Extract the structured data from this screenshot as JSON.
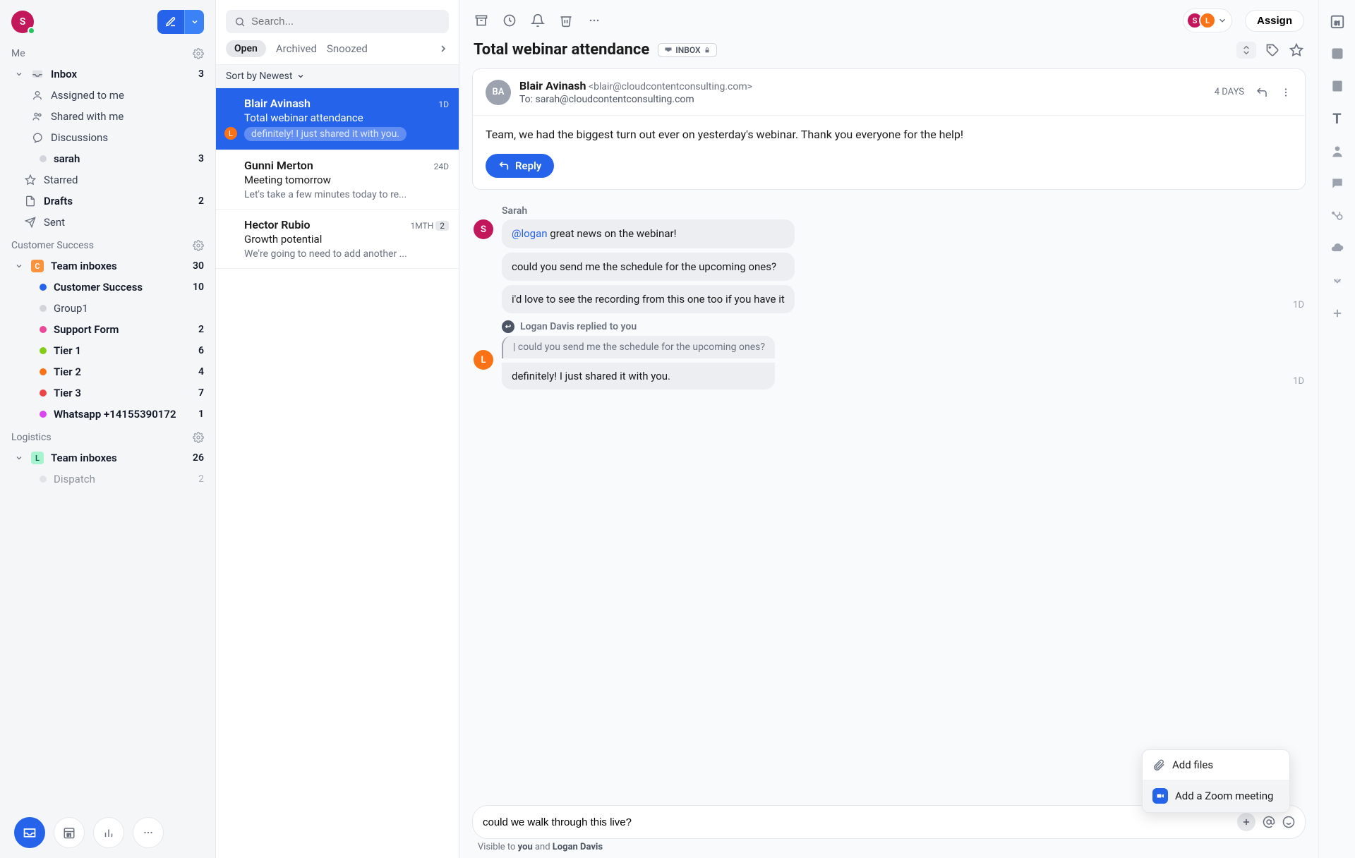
{
  "user_avatar_letter": "S",
  "sidebar": {
    "sections": [
      {
        "name": "Me"
      },
      {
        "name": "Customer Success"
      },
      {
        "name": "Logistics"
      }
    ],
    "me_items": {
      "inbox": {
        "label": "Inbox",
        "count": "3"
      },
      "assigned": {
        "label": "Assigned to me"
      },
      "shared": {
        "label": "Shared with me"
      },
      "discussions": {
        "label": "Discussions"
      },
      "sarah": {
        "label": "sarah",
        "count": "3"
      },
      "starred": {
        "label": "Starred"
      },
      "drafts": {
        "label": "Drafts",
        "count": "2"
      },
      "sent": {
        "label": "Sent"
      }
    },
    "cs": {
      "team": {
        "label": "Team inboxes",
        "count": "30"
      },
      "items": [
        {
          "label": "Customer Success",
          "count": "10",
          "color": "#2563eb"
        },
        {
          "label": "Group1",
          "count": "",
          "color": "#d1d5db"
        },
        {
          "label": "Support Form",
          "count": "2",
          "color": "#ec4899"
        },
        {
          "label": "Tier 1",
          "count": "6",
          "color": "#84cc16"
        },
        {
          "label": "Tier 2",
          "count": "4",
          "color": "#f97316"
        },
        {
          "label": "Tier 3",
          "count": "7",
          "color": "#ef4444"
        },
        {
          "label": "Whatsapp +14155390172",
          "count": "1",
          "color": "#d946ef"
        }
      ]
    },
    "logistics": {
      "team": {
        "label": "Team inboxes",
        "count": "26"
      },
      "items": [
        {
          "label": "Dispatch",
          "count": "2",
          "color": "#d1d5db"
        }
      ]
    }
  },
  "list": {
    "search_placeholder": "Search...",
    "tabs": {
      "open": "Open",
      "archived": "Archived",
      "snoozed": "Snoozed"
    },
    "sort": "Sort by Newest",
    "items": [
      {
        "sender": "Blair Avinash",
        "time": "1D",
        "subject": "Total webinar attendance",
        "preview": "definitely! I just shared it with you.",
        "selected": true,
        "badge": "L"
      },
      {
        "sender": "Gunni Merton",
        "time": "24D",
        "subject": "Meeting tomorrow",
        "preview": "Let's take a few minutes today to re..."
      },
      {
        "sender": "Hector Rubio",
        "time": "1MTH",
        "subject": "Growth potential",
        "preview": "We're going to need to add another ...",
        "num": "2"
      }
    ]
  },
  "reader": {
    "assign": "Assign",
    "title": "Total webinar attendance",
    "inbox_tag": "INBOX",
    "email": {
      "from_name": "Blair Avinash",
      "from_email": "<blair@cloudcontentconsulting.com>",
      "to_label": "To: sarah@cloudcontentconsulting.com",
      "age": "4 DAYS",
      "avatar": "BA",
      "body": "Team, we had the biggest turn out ever on yesterday's webinar. Thank you everyone for the help!",
      "reply_btn": "Reply"
    },
    "thread": {
      "sarah": {
        "name": "Sarah",
        "letter": "S",
        "mention": "@logan",
        "msg1_rest": " great news on the webinar!",
        "msg2": "could you send me the schedule for the upcoming ones?",
        "msg3": "i'd love to see the recording from this one too if you have it",
        "time": "1D"
      },
      "logan": {
        "note": "Logan Davis replied to you",
        "letter": "L",
        "quote": "could you send me the schedule for the upcoming ones?",
        "reply": "definitely! I just shared it with you.",
        "time": "1D"
      }
    },
    "popup": {
      "files": "Add files",
      "zoom": "Add a Zoom meeting"
    },
    "composer_value": "could we walk through this live?",
    "visibility_prefix": "Visible to ",
    "visibility_you": "you",
    "visibility_and": " and ",
    "visibility_other": "Logan Davis"
  }
}
